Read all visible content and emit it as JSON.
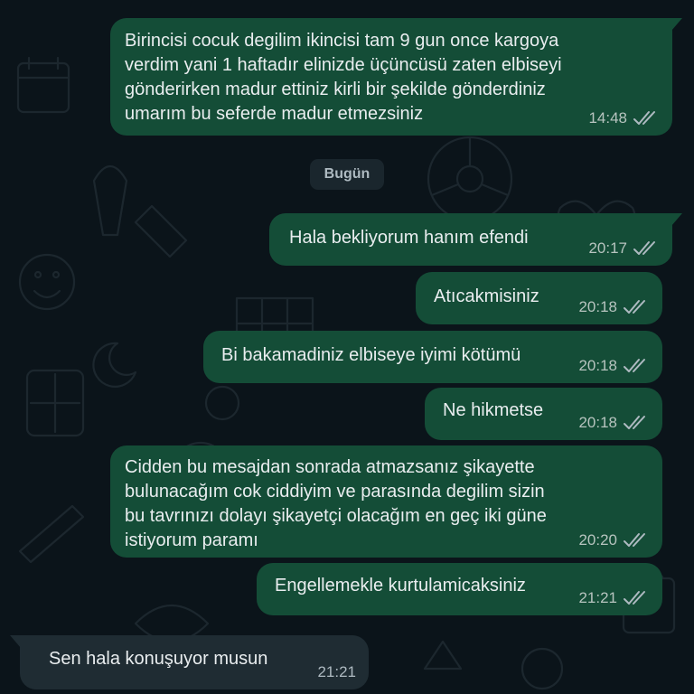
{
  "colors": {
    "background": "#0b141a",
    "outgoing_bubble": "#144d37",
    "incoming_bubble": "#1f2c33",
    "tick_color": "#aebac1"
  },
  "date_divider": "Bugün",
  "messages": [
    {
      "direction": "outgoing",
      "text": "Birincisi cocuk degilim ikincisi tam 9 gun once kargoya\nverdim yani 1 haftadır elinizde üçüncüsü zaten elbiseyi\ngönderirken madur ettiniz kirli bir şekilde gönderdiniz\numarım bu seferde madur etmezsiniz",
      "time": "14:48",
      "status_icon": "double-check-icon"
    },
    {
      "direction": "outgoing",
      "text": "Hala bekliyorum hanım efendi",
      "time": "20:17",
      "status_icon": "double-check-icon"
    },
    {
      "direction": "outgoing",
      "text": "Atıcakmisiniz",
      "time": "20:18",
      "status_icon": "double-check-icon"
    },
    {
      "direction": "outgoing",
      "text": "Bi bakamadiniz elbiseye iyimi kötümü",
      "time": "20:18",
      "status_icon": "double-check-icon"
    },
    {
      "direction": "outgoing",
      "text": "Ne hikmetse",
      "time": "20:18",
      "status_icon": "double-check-icon"
    },
    {
      "direction": "outgoing",
      "text": "Cidden bu mesajdan sonrada atmazsanız şikayette\nbulunacağım cok ciddiyim ve parasında degilim sizin\nbu tavrınızı dolayı şikayetçi olacağım en geç iki güne\nistiyorum paramı",
      "time": "20:20",
      "status_icon": "double-check-icon"
    },
    {
      "direction": "outgoing",
      "text": "Engellemekle kurtulamicaksiniz",
      "time": "21:21",
      "status_icon": "double-check-icon"
    },
    {
      "direction": "incoming",
      "text": "Sen hala konuşuyor musun",
      "time": "21:21"
    }
  ]
}
